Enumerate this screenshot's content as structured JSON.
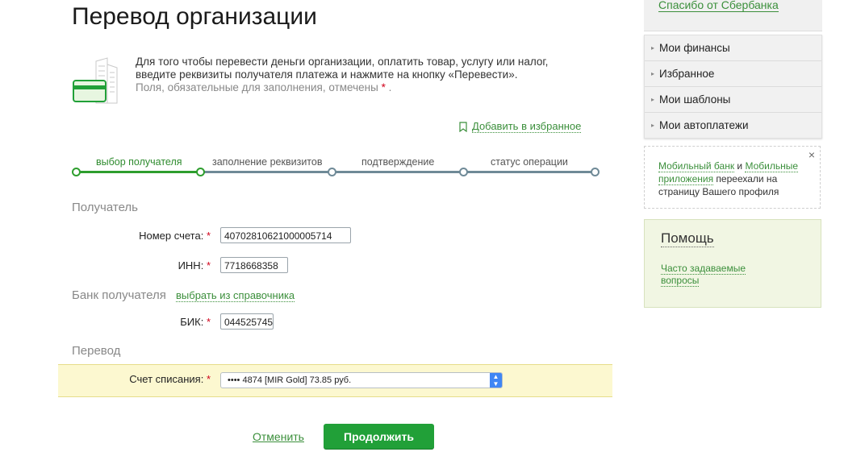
{
  "page": {
    "title": "Перевод организации",
    "intro_line1": "Для того чтобы перевести деньги организации, оплатить товар, услугу или налог,",
    "intro_line2": "введите реквизиты получателя платежа и нажмите на кнопку «Перевести».",
    "required_note": "Поля, обязательные для заполнения, отмечены",
    "required_star": "*",
    "required_end": ".",
    "add_favorite": "Добавить в избранное"
  },
  "steps": [
    {
      "label": "выбор получателя",
      "active": true
    },
    {
      "label": "заполнение реквизитов",
      "active": false
    },
    {
      "label": "подтверждение",
      "active": false
    },
    {
      "label": "статус операции",
      "active": false
    }
  ],
  "recipient": {
    "section_title": "Получатель",
    "account_label": "Номер счета:",
    "account_value": "40702810621000005714",
    "inn_label": "ИНН:",
    "inn_value": "7718668358"
  },
  "bank": {
    "section_title": "Банк получателя",
    "choose_link": "выбрать из справочника",
    "bik_label": "БИК:",
    "bik_value": "044525745"
  },
  "transfer": {
    "section_title": "Перевод",
    "debit_label": "Счет списания:",
    "debit_value": "•••• 4874  [MIR Gold] 73.85 руб."
  },
  "actions": {
    "cancel": "Отменить",
    "continue": "Продолжить"
  },
  "sidebar": {
    "thanks_link": "Спасибо от Сбербанка",
    "menu": [
      "Мои финансы",
      "Избранное",
      "Мои шаблоны",
      "Мои автоплатежи"
    ],
    "notice": {
      "link1": "Мобильный банк",
      "and": " и ",
      "link2": "Мобильные приложения",
      "text": " переехали на страницу Вашего профиля",
      "close": "×"
    },
    "help": {
      "title": "Помощь",
      "faq": "Часто задаваемые вопросы"
    }
  },
  "colors": {
    "accent_green": "#21a038",
    "link_green": "#3b8f3b",
    "required_red": "#d0021b",
    "highlight": "#fcf8d0"
  }
}
